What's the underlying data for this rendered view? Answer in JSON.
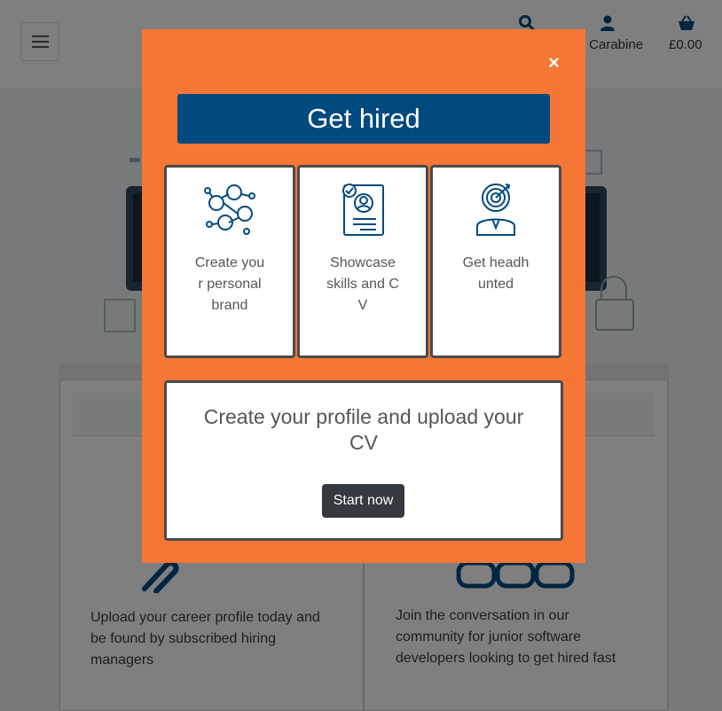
{
  "header": {
    "account_label": "Iris Carabine",
    "basket_label": "£0.00",
    "icons": [
      "menu-icon",
      "search-icon",
      "user-icon",
      "basket-icon"
    ]
  },
  "background_cards": [
    {
      "text": "Upload your career profile today and be found by subscribed hiring managers"
    },
    {
      "text": "Join the conversation in our community for junior software developers looking to get hired fast"
    }
  ],
  "modal": {
    "close_label": "×",
    "title": "Get hired",
    "features": [
      {
        "label": "Create your personal brand",
        "icon": "network-people-icon"
      },
      {
        "label": "Showcase skills and CV",
        "icon": "cv-document-icon"
      },
      {
        "label": "Get headhunted",
        "icon": "target-person-icon"
      }
    ],
    "cta_text": "Create your profile and upload your CV",
    "cta_button": "Start now"
  },
  "colors": {
    "modal_bg": "#f47735",
    "title_bg": "#004a80",
    "button_bg": "#343a40",
    "icon_blue": "#004a80"
  }
}
